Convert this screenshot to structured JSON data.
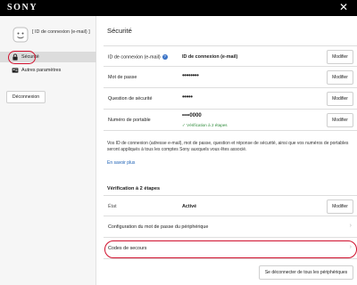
{
  "header": {
    "brand": "SONY",
    "close_glyph": "✕"
  },
  "sidebar": {
    "user_id": "[ ID de connexion (e-mail) ]",
    "items": [
      {
        "label": "Sécurité",
        "icon": "lock-icon",
        "selected": true
      },
      {
        "label": "Autres paramètres",
        "icon": "settings-card-icon",
        "selected": false
      }
    ],
    "logout_label": "Déconnexion",
    "highlight_color": "#d0102d"
  },
  "main": {
    "title": "Sécurité",
    "rows": [
      {
        "label": "ID de connexion (e-mail)",
        "value": "ID de connexion (e-mail)",
        "button": "Modifier"
      },
      {
        "label": "Mot de passe",
        "value": "••••••••",
        "button": "Modifier"
      },
      {
        "label": "Question de sécurité",
        "value": "•••••",
        "button": "Modifier"
      },
      {
        "label": "Numéro de portable",
        "value": "••••0000",
        "verified": "Vérification à 2 étapes",
        "button": "Modifier"
      }
    ],
    "note": "Vos ID de connexion (adresse e-mail), mot de passe, question et réponse de sécurité, ainsi que vos numéros de portables seront appliqués à tous les comptes Sony auxquels vous êtes associé.",
    "learn_more": "En savoir plus",
    "two_step": {
      "heading": "Vérification à 2 étapes",
      "state_label": "État",
      "state_value": "Activé",
      "state_button": "Modifier",
      "device_pw_label": "Configuration du mot de passe du périphérique",
      "backup_codes_label": "Codes de secours"
    },
    "disconnect_all_label": "Se déconnecter de tous les périphériques"
  },
  "colors": {
    "header_bg": "#000000",
    "verified_green": "#2e8b3a",
    "link_blue": "#1a5fb4",
    "annotation_red": "#d0102d"
  }
}
